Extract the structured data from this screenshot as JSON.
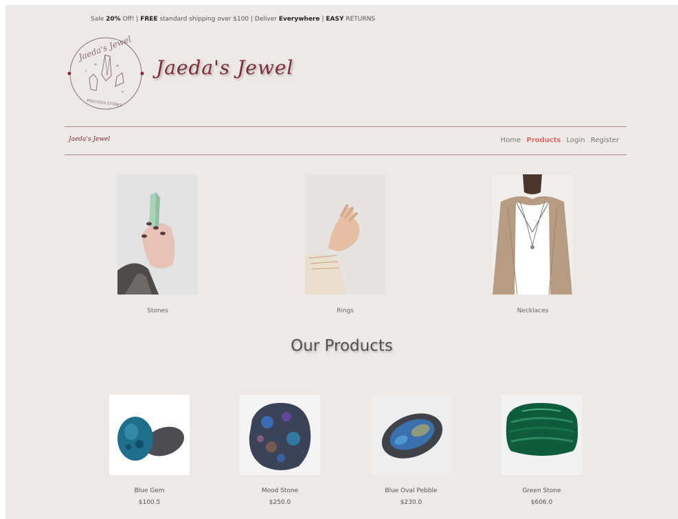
{
  "promo": {
    "part1": "Sale ",
    "pct": "20%",
    "part2": " Off! | ",
    "free": "FREE",
    "part3": " standard shipping over $100 | Deliver ",
    "everywhere": "Everywhere",
    "part4": " | ",
    "easy": "EASY",
    "part5": " RETURNS"
  },
  "logo": {
    "script_text": "Jaeda's Jewel",
    "ring_text": "PRECIOUS STONES"
  },
  "brand_title": "Jaeda's Jewel",
  "nav": {
    "brand": "Jaeda's Jewel",
    "links": [
      "Home",
      "Products",
      "Login",
      "Register"
    ],
    "active": "Products"
  },
  "categories": [
    {
      "label": "Stones"
    },
    {
      "label": "Rings"
    },
    {
      "label": "Necklaces"
    }
  ],
  "section_title": "Our Products",
  "products": [
    {
      "name": "Blue Gem",
      "price": "$100.5"
    },
    {
      "name": "Mood Stone",
      "price": "$250.0"
    },
    {
      "name": "Blue Oval Pebble",
      "price": "$230.0"
    },
    {
      "name": "Green Stone",
      "price": "$606.0"
    }
  ],
  "colors": {
    "brand": "#7e2b35",
    "active_link": "#e26b67",
    "background": "#ede9e6"
  }
}
